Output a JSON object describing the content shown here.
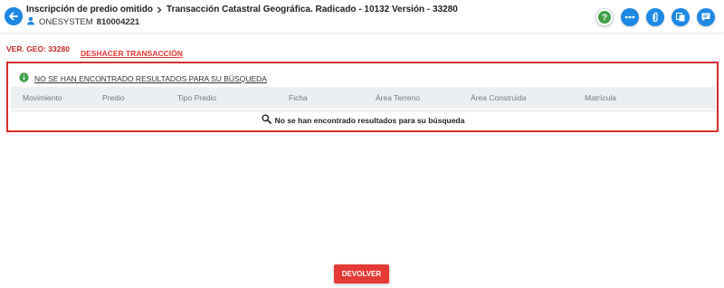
{
  "header": {
    "breadcrumb": [
      "Inscripción de predio omitido",
      "Transacción Catastral Geográfica. Radicado - 10132 Versión - 33280"
    ],
    "user_name": "ONESYSTEM",
    "user_id": "810004221"
  },
  "actions": [
    {
      "icon": "help-icon"
    },
    {
      "icon": "more-icon"
    },
    {
      "icon": "attach-icon"
    },
    {
      "icon": "copy-icon"
    },
    {
      "icon": "comments-icon"
    }
  ],
  "ver_geo": "VER. GEO: 33280",
  "undo_label": "DESHACER TRANSACCIÓN",
  "notice": "NO SE HAN ENCONTRADO RESULTADOS PARA SU BÚSQUEDA",
  "table": {
    "columns": [
      "Movimiento",
      "Predio",
      "Tipo Predio",
      "Ficha",
      "Área Terreno",
      "Área Construida",
      "Matrícula"
    ],
    "empty_message": "No se han encontrado resultados para su búsqueda"
  },
  "devolver_label": "DEVOLVER",
  "colors": {
    "primary": "#1e88e5",
    "danger": "#e53935",
    "success": "#43a047"
  }
}
